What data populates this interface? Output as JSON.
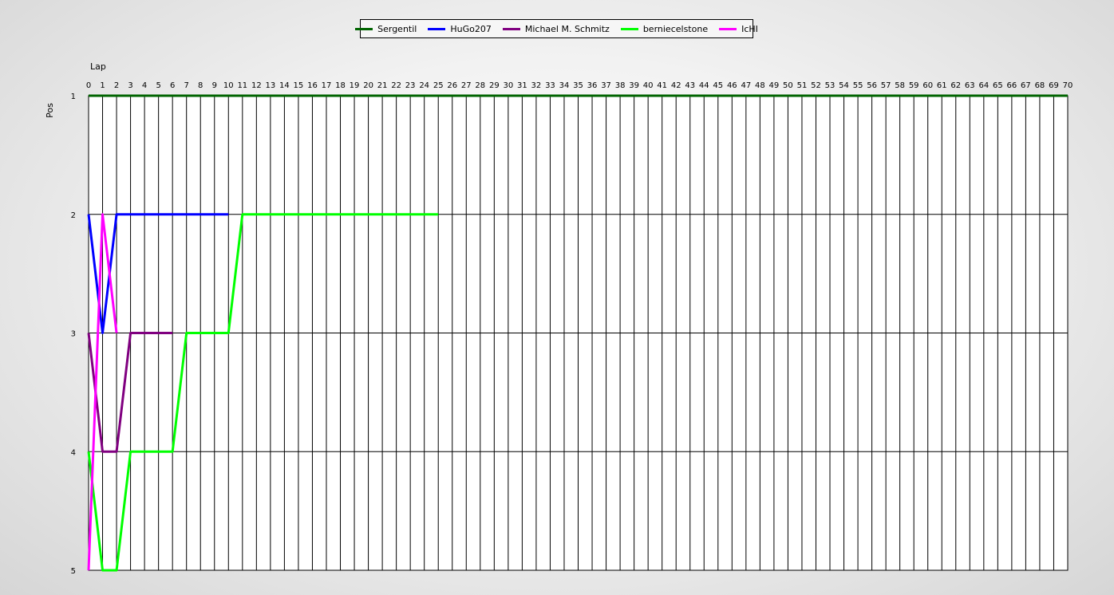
{
  "chart_data": {
    "type": "line",
    "xlabel": "Lap",
    "ylabel": "Pos",
    "xlim": [
      0,
      70
    ],
    "ylim": [
      1,
      5
    ],
    "y_inverted": true,
    "grid": true,
    "legend_position": "top-center",
    "x_ticks": [
      0,
      1,
      2,
      3,
      4,
      5,
      6,
      7,
      8,
      9,
      10,
      11,
      12,
      13,
      14,
      15,
      16,
      17,
      18,
      19,
      20,
      21,
      22,
      23,
      24,
      25,
      26,
      27,
      28,
      29,
      30,
      31,
      32,
      33,
      34,
      35,
      36,
      37,
      38,
      39,
      40,
      41,
      42,
      43,
      44,
      45,
      46,
      47,
      48,
      49,
      50,
      51,
      52,
      53,
      54,
      55,
      56,
      57,
      58,
      59,
      60,
      61,
      62,
      63,
      64,
      65,
      66,
      67,
      68,
      69,
      70
    ],
    "y_ticks": [
      1,
      2,
      3,
      4,
      5
    ],
    "series": [
      {
        "name": "Sergentil",
        "color": "#006400",
        "x": [
          0,
          70
        ],
        "y": [
          1,
          1
        ]
      },
      {
        "name": "HuGo207",
        "color": "#0000ff",
        "x": [
          0,
          1,
          2,
          3,
          4,
          5,
          6,
          7,
          8,
          9,
          10
        ],
        "y": [
          2,
          3,
          2,
          2,
          2,
          2,
          2,
          2,
          2,
          2,
          2
        ]
      },
      {
        "name": "Michael M. Schmitz",
        "color": "#800080",
        "x": [
          0,
          1,
          2,
          3,
          4,
          5,
          6
        ],
        "y": [
          3,
          4,
          4,
          3,
          3,
          3,
          3
        ]
      },
      {
        "name": "berniecelstone",
        "color": "#00ff00",
        "x": [
          0,
          1,
          2,
          3,
          4,
          5,
          6,
          7,
          8,
          9,
          10,
          11,
          12,
          13,
          14,
          15,
          16,
          17,
          18,
          19,
          20,
          21,
          22,
          23,
          24,
          25
        ],
        "y": [
          4,
          5,
          5,
          4,
          4,
          4,
          4,
          3,
          3,
          3,
          3,
          2,
          2,
          2,
          2,
          2,
          2,
          2,
          2,
          2,
          2,
          2,
          2,
          2,
          2,
          2
        ]
      },
      {
        "name": "IcHI",
        "color": "#ff00ff",
        "x": [
          0,
          1,
          2
        ],
        "y": [
          5,
          2,
          3
        ]
      }
    ]
  }
}
